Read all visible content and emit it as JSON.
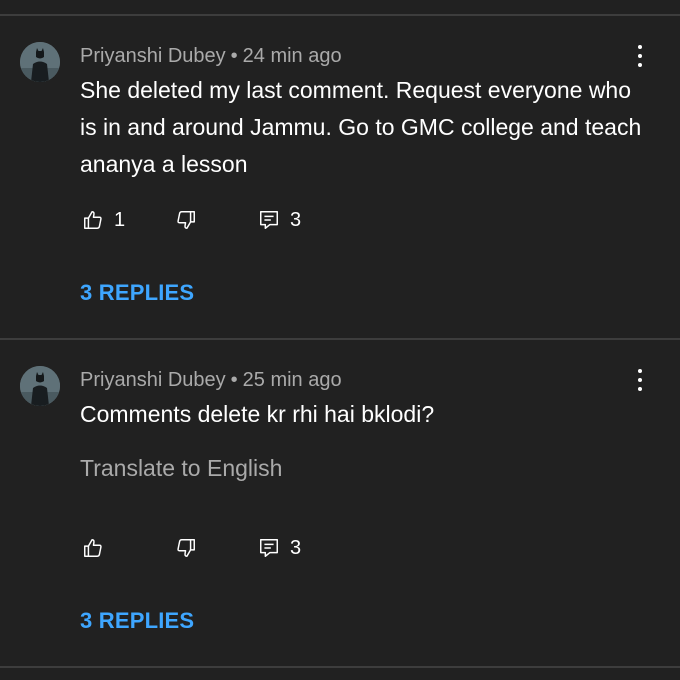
{
  "comments": [
    {
      "author": "Priyanshi Dubey",
      "separator": "•",
      "time": "24 min ago",
      "text": "She deleted my last comment. Request everyone who is in and around Jammu. Go to GMC college and teach ananya a lesson",
      "likes": "1",
      "reply_count": "3",
      "replies_label": "3 REPLIES"
    },
    {
      "author": "Priyanshi Dubey",
      "separator": "•",
      "time": "25 min ago",
      "text": "Comments delete kr rhi hai bklodi?",
      "translate_label": "Translate to English",
      "likes": "",
      "reply_count": "3",
      "replies_label": "3 REPLIES"
    }
  ],
  "icons": {
    "like": "thumbs-up-icon",
    "dislike": "thumbs-down-icon",
    "reply": "reply-comment-icon",
    "menu": "more-vertical-icon"
  },
  "colors": {
    "background": "#212121",
    "divider": "#3d3d3d",
    "meta_text": "#aaaaaa",
    "link_blue": "#3ea6ff"
  }
}
